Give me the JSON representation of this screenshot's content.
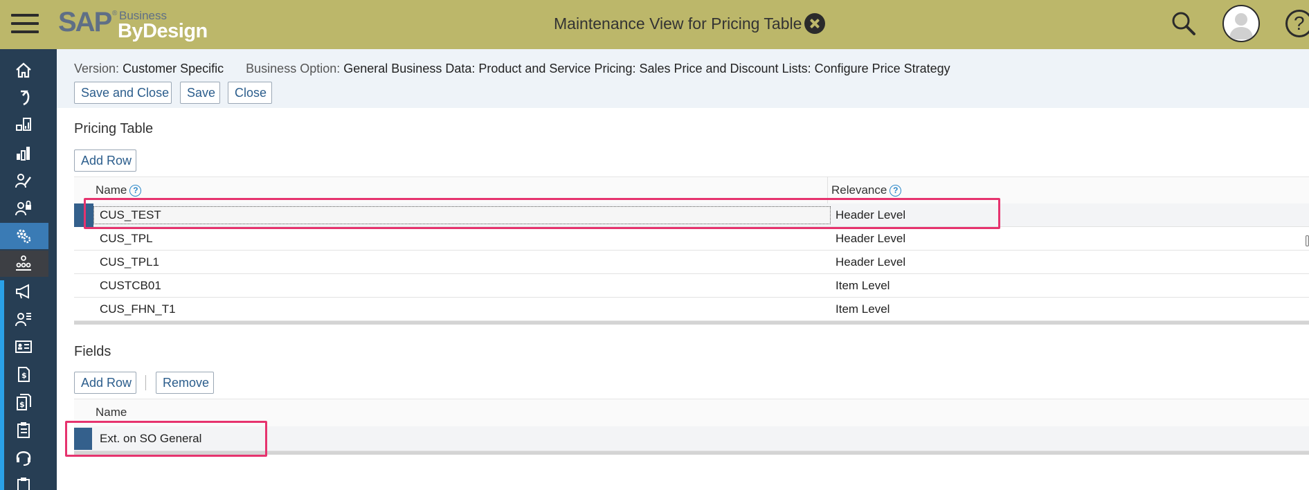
{
  "shell": {
    "logo_sap": "SAP",
    "logo_business": "Business",
    "logo_bydesign": "ByDesign",
    "title": "Maintenance View for Pricing Table"
  },
  "icons": {
    "menu": "hamburger-menu-icon",
    "close": "close-circle-icon",
    "search": "search-icon",
    "avatar": "user-avatar-icon",
    "help": "help-icon"
  },
  "left_nav": [
    {
      "id": "home",
      "icon": "home-icon"
    },
    {
      "id": "refresh",
      "icon": "refresh-icon"
    },
    {
      "id": "analytics",
      "icon": "analytics-icon"
    },
    {
      "id": "reports",
      "icon": "bar-chart-icon"
    },
    {
      "id": "edit-user",
      "icon": "user-edit-icon"
    },
    {
      "id": "user-lock",
      "icon": "user-lock-icon"
    },
    {
      "id": "settings",
      "icon": "gears-icon"
    },
    {
      "id": "org",
      "icon": "org-chart-icon"
    },
    {
      "id": "marketing",
      "icon": "megaphone-icon"
    },
    {
      "id": "contacts",
      "icon": "user-list-icon"
    },
    {
      "id": "business-card",
      "icon": "id-card-icon"
    },
    {
      "id": "sales-doc",
      "icon": "dollar-doc-icon"
    },
    {
      "id": "price-doc",
      "icon": "dollar-docs-icon"
    },
    {
      "id": "clipboard",
      "icon": "clipboard-icon"
    },
    {
      "id": "support",
      "icon": "headset-icon"
    },
    {
      "id": "tasks",
      "icon": "clipboard-lock-icon"
    }
  ],
  "meta": {
    "version_label": "Version:",
    "version_value": "Customer Specific",
    "option_label": "Business Option:",
    "option_value": "General Business Data: Product and Service Pricing: Sales Price and Discount Lists: Configure Price Strategy"
  },
  "toolbar": {
    "save_and_close": "Save and Close",
    "save": "Save",
    "close": "Close"
  },
  "pricing_table": {
    "title": "Pricing Table",
    "add_row": "Add Row",
    "columns": {
      "name": "Name",
      "relevance": "Relevance"
    },
    "rows": [
      {
        "name": "CUS_TEST",
        "relevance": "Header Level"
      },
      {
        "name": "CUS_TPL",
        "relevance": "Header Level"
      },
      {
        "name": "CUS_TPL1",
        "relevance": "Header Level"
      },
      {
        "name": "CUSTCB01",
        "relevance": "Item Level"
      },
      {
        "name": "CUS_FHN_T1",
        "relevance": "Item Level"
      }
    ]
  },
  "fields": {
    "title": "Fields",
    "add_row": "Add Row",
    "remove": "Remove",
    "columns": {
      "name": "Name"
    },
    "rows": [
      {
        "name": "Ext. on SO General"
      }
    ]
  },
  "colors": {
    "shell": "#bcb76a",
    "nav": "#273e54",
    "nav_active": "#3a7bb5",
    "accent_strip": "#2aa1e8",
    "link_text": "#2b5d8c",
    "highlight": "#e6336e",
    "selection": "#34608c"
  }
}
